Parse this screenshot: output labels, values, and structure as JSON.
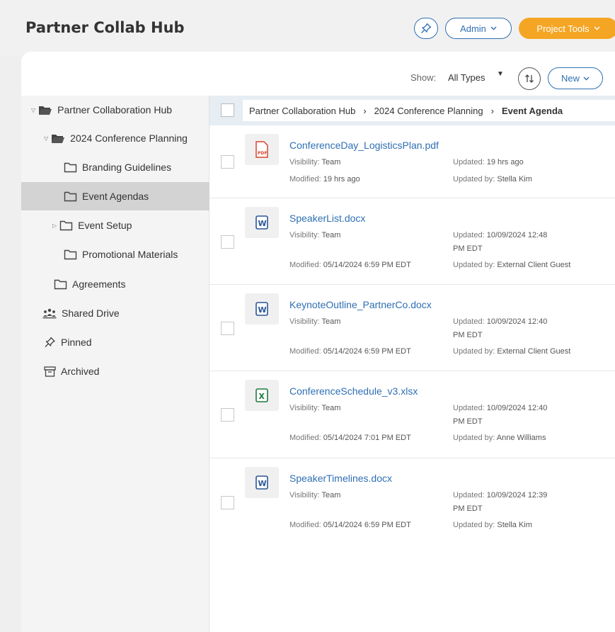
{
  "header": {
    "title": "Partner Collab Hub",
    "admin_label": "Admin",
    "tools_label": "Project Tools"
  },
  "toolbar": {
    "show_label": "Show:",
    "show_value": "All Types",
    "new_label": "New"
  },
  "sidebar": {
    "items": [
      {
        "label": "Partner Collaboration Hub",
        "icon": "folder-open-icon"
      },
      {
        "label": "2024 Conference Planning",
        "icon": "folder-open-icon"
      },
      {
        "label": "Branding Guidelines",
        "icon": "folder-icon"
      },
      {
        "label": "Event Agendas",
        "icon": "folder-icon",
        "selected": true
      },
      {
        "label": "Event Setup",
        "icon": "folder-icon"
      },
      {
        "label": "Promotional Materials",
        "icon": "folder-icon"
      },
      {
        "label": "Agreements",
        "icon": "folder-icon"
      },
      {
        "label": "Shared Drive",
        "icon": "people-icon"
      },
      {
        "label": "Pinned",
        "icon": "pin-icon"
      },
      {
        "label": "Archived",
        "icon": "archive-icon"
      }
    ]
  },
  "breadcrumb": {
    "items": [
      "Partner Collaboration Hub",
      "2024 Conference Planning",
      "Event Agenda"
    ]
  },
  "labels": {
    "visibility": "Visibility:",
    "modified": "Modified:",
    "updated": "Updated:",
    "updated_by": "Updated by:"
  },
  "files": [
    {
      "name": "ConferenceDay_LogisticsPlan.pdf",
      "type": "pdf",
      "type_badge": "PDF",
      "visibility": "Team",
      "modified": "19 hrs ago",
      "updated_line1": "19 hrs ago",
      "updated_line2": "",
      "updated_by": "Stella Kim"
    },
    {
      "name": "SpeakerList.docx",
      "type": "word",
      "type_badge": "W",
      "visibility": "Team",
      "modified": "05/14/2024 6:59 PM EDT",
      "updated_line1": "10/09/2024 12:48",
      "updated_line2": "PM EDT",
      "updated_by": "External Client Guest"
    },
    {
      "name": "KeynoteOutline_PartnerCo.docx",
      "type": "word",
      "type_badge": "W",
      "visibility": "Team",
      "modified": "05/14/2024 6:59 PM EDT",
      "updated_line1": "10/09/2024 12:40",
      "updated_line2": "PM EDT",
      "updated_by": "External Client Guest"
    },
    {
      "name": "ConferenceSchedule_v3.xlsx",
      "type": "excel",
      "type_badge": "X",
      "visibility": "Team",
      "modified": "05/14/2024 7:01 PM EDT",
      "updated_line1": "10/09/2024 12:40",
      "updated_line2": "PM EDT",
      "updated_by": "Anne Williams"
    },
    {
      "name": "SpeakerTimelines.docx",
      "type": "word",
      "type_badge": "W",
      "visibility": "Team",
      "modified": "05/14/2024 6:59 PM EDT",
      "updated_line1": "10/09/2024 12:39",
      "updated_line2": "PM EDT",
      "updated_by": "Stella Kim"
    }
  ],
  "colors": {
    "accent": "#2f6fb3",
    "brand_orange": "#f5a524",
    "pdf_red": "#d9452f",
    "word_blue": "#2b5797",
    "excel_green": "#1f7a3f",
    "selected_bg": "#d3d3d3"
  }
}
